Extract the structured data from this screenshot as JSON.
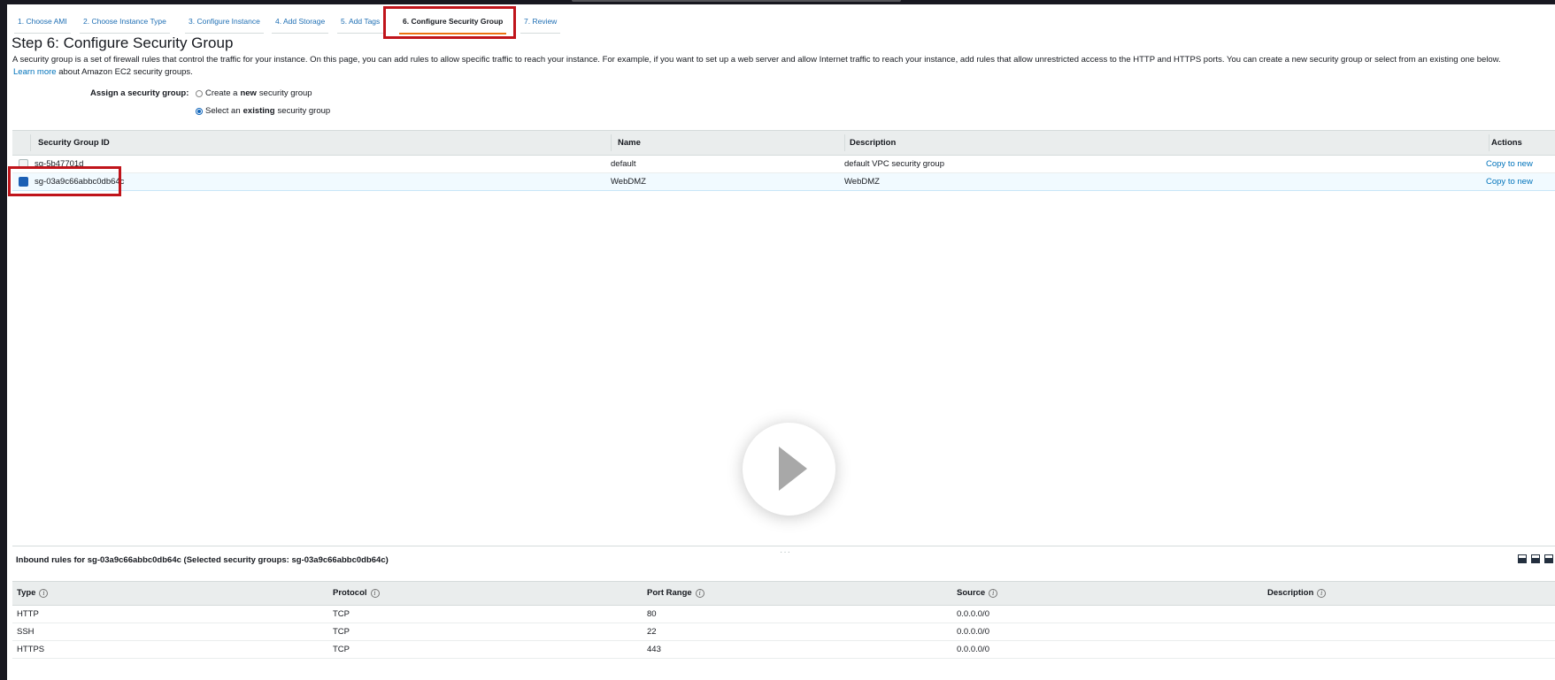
{
  "wizard": {
    "tabs": [
      {
        "label": "1. Choose AMI"
      },
      {
        "label": "2. Choose Instance Type"
      },
      {
        "label": "3. Configure Instance"
      },
      {
        "label": "4. Add Storage"
      },
      {
        "label": "5. Add Tags"
      },
      {
        "label": "6. Configure Security Group"
      },
      {
        "label": "7. Review"
      }
    ],
    "active_tab": "6. Configure Security Group"
  },
  "step": {
    "title": "Step 6: Configure Security Group",
    "description": "A security group is a set of firewall rules that control the traffic for your instance. On this page, you can add rules to allow specific traffic to reach your instance. For example, if you want to set up a web server and allow Internet traffic to reach your instance, add rules that allow unrestricted access to the HTTP and HTTPS ports. You can create a new security group or select from an existing one below.",
    "learn_more": "Learn more",
    "learn_more_suffix": "about Amazon EC2 security groups."
  },
  "assign": {
    "label": "Assign a security group:",
    "option_new_pre": "Create a",
    "option_new_bold": "new",
    "option_new_post": "security group",
    "option_existing_pre": "Select an",
    "option_existing_bold": "existing",
    "option_existing_post": "security group",
    "selected": "existing"
  },
  "sg_table": {
    "headers": {
      "id": "Security Group ID",
      "name": "Name",
      "description": "Description",
      "actions": "Actions"
    },
    "rows": [
      {
        "id": "sg-5b47701d",
        "name": "default",
        "description": "default VPC security group",
        "action": "Copy to new",
        "checked": false
      },
      {
        "id": "sg-03a9c66abbc0db64c",
        "name": "WebDMZ",
        "description": "WebDMZ",
        "action": "Copy to new",
        "checked": true
      }
    ]
  },
  "inbound": {
    "title": "Inbound rules for sg-03a9c66abbc0db64c (Selected security groups: sg-03a9c66abbc0db64c)",
    "headers": {
      "type": "Type",
      "protocol": "Protocol",
      "port_range": "Port Range",
      "source": "Source",
      "description": "Description"
    },
    "rows": [
      {
        "type": "HTTP",
        "protocol": "TCP",
        "port_range": "80",
        "source": "0.0.0.0/0"
      },
      {
        "type": "SSH",
        "protocol": "TCP",
        "port_range": "22",
        "source": "0.0.0.0/0"
      },
      {
        "type": "HTTPS",
        "protocol": "TCP",
        "port_range": "443",
        "source": "0.0.0.0/0"
      }
    ]
  },
  "icons": {
    "play": "play-icon",
    "info": "info-icon",
    "panel": "panel-layout-icon"
  },
  "colors": {
    "link": "#0073bb",
    "active_tab_underline": "#ec7211",
    "highlight_box": "#c0141b",
    "selected_row": "#f1faff"
  }
}
